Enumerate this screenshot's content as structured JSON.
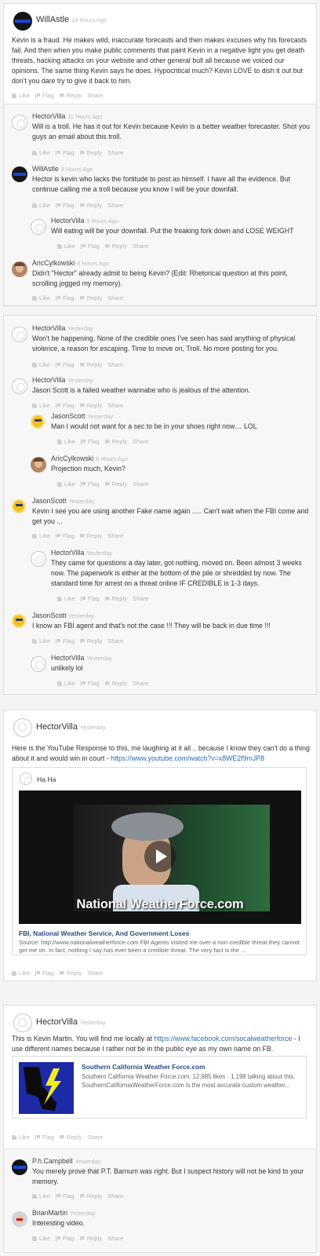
{
  "actions": {
    "like": "Like",
    "flag": "Flag",
    "reply": "Reply",
    "share": "Share"
  },
  "thread1": {
    "c1": {
      "author": "WillAstle",
      "time": "14 Hours Ago",
      "text": "Kevin is a fraud. He makes wild, inaccurate forecasts and then makes excuses why his forecasts fail. And then when you make public comments that paint Kevin in a negative light you get death threats, hacking attacks on your website and other general bull all because we voiced our opinions. The same thing Kevin says he does. Hypocritical much? Kevin LOVE to dish it out but don't you dare try to give it back to him."
    },
    "c2": {
      "author": "HectorVilla",
      "time": "11 Hours Ago",
      "text": "Will is a troll. He has it out for Kevin because Kevin is a better weather forecaster. Shot you guys an email about this troll."
    },
    "c3": {
      "author": "WillAstle",
      "time": "9 Hours Ago",
      "text": "Hector is kevin who lacks the fortitude to post as himself. I have all the evidence. But continue calling me a troll because you know I will be your downfall."
    },
    "c4": {
      "author": "HectorVilla",
      "time": "9 Hours Ago",
      "text": "Will eating will be your downfall. Put the freaking fork down and LOSE WEIGHT"
    },
    "c5": {
      "author": "AricCylkowski",
      "time": "6 Hours Ago",
      "text": "Didn't \"Hector\" already admit to being Kevin? (Edit: Rhetorical question at this point, scrolling jogged my memory)."
    }
  },
  "thread2": {
    "c1": {
      "author": "HectorVilla",
      "time": "Yesterday",
      "text": "Won't be happening. None of the credible ones I've seen has said anything of physical violence, a reason for escaping. Time to move on, Troll. No more posting for you."
    },
    "c2": {
      "author": "HectorVilla",
      "time": "Yesterday",
      "text": "Jason Scott is a failed weather wannabe who is jealous of the attention."
    },
    "c3": {
      "author": "JasonScott",
      "time": "Yesterday",
      "text": "Man I would not want for a sec to be in your shoes right now.... LOL"
    },
    "c4": {
      "author": "AricCylkowski",
      "time": "6 Hours Ago",
      "text": "Projection much, Kevin?"
    },
    "c5": {
      "author": "JasonScott",
      "time": "Yesterday",
      "text": "Kevin I see you are using another Fake name again ..... Can't wait when the FBI come and get you ..."
    },
    "c6": {
      "author": "HectorVilla",
      "time": "Yesterday",
      "text": "They came for questions a day later, got nothing, moved on. Been almost 3 weeks now. The paperwork is either at the bottom of the pile or shredded by now. The standard time for arrest on a threat online IF CREDIBLE is 1-3 days."
    },
    "c7": {
      "author": "JasonScott",
      "time": "Yesterday",
      "text": "I know an FBI agent and that's not the case !!! They will be back in due time !!!"
    },
    "c8": {
      "author": "HectorVilla",
      "time": "Yesterday",
      "text": "unlikely lol"
    }
  },
  "thread3": {
    "author": "HectorVilla",
    "time": "Yesterday",
    "text": "Here is the YouTube Response to this, me laughing at it all .. because I know they can't do a thing about it and would win in court - ",
    "link": "https://www.youtube.com/watch?v=x8WE2f9mJP8",
    "embed": {
      "header": "Ha Ha",
      "video_caption": "National WeatherForce.com",
      "title": "FBI, National Weather Service, And Government Loses",
      "description": "Source: http://www.nationalweatherforce.com FBI Agents visited me over a non-credible threat they cannot get me on. In fact, nothing I say has ever been a credible threat. The very fact is the ..."
    }
  },
  "thread4": {
    "author": "HectorVilla",
    "time": "Yesterday",
    "text_before": "This is Kevin Martin. You will find me locally at ",
    "link": "https://www.facebook.com/socalweatherforce",
    "text_after": " - I use different names because I rather not be in the public eye as my own name on FB.",
    "embed": {
      "title": "Southern California Weather Force.com",
      "description": "Southern California Weather Force.com. 12,985 likes · 1,198 talking about this. SouthernCaliforniaWeatherForce.com is the most accurate custom weather..."
    },
    "c2": {
      "author": "P.h.Campbell",
      "time": "Yesterday",
      "text": "You merely prove that P.T. Barnum was right. But I suspect history will not be kind to your memory."
    },
    "c3": {
      "author": "BrianMartin",
      "time": "Yesterday",
      "text": "Interesting video."
    }
  },
  "colors": {
    "link": "#2a6db5",
    "accent_blue": "#1d46d4",
    "video_bg": "#111111",
    "logo_yellow": "#f2ea26"
  }
}
